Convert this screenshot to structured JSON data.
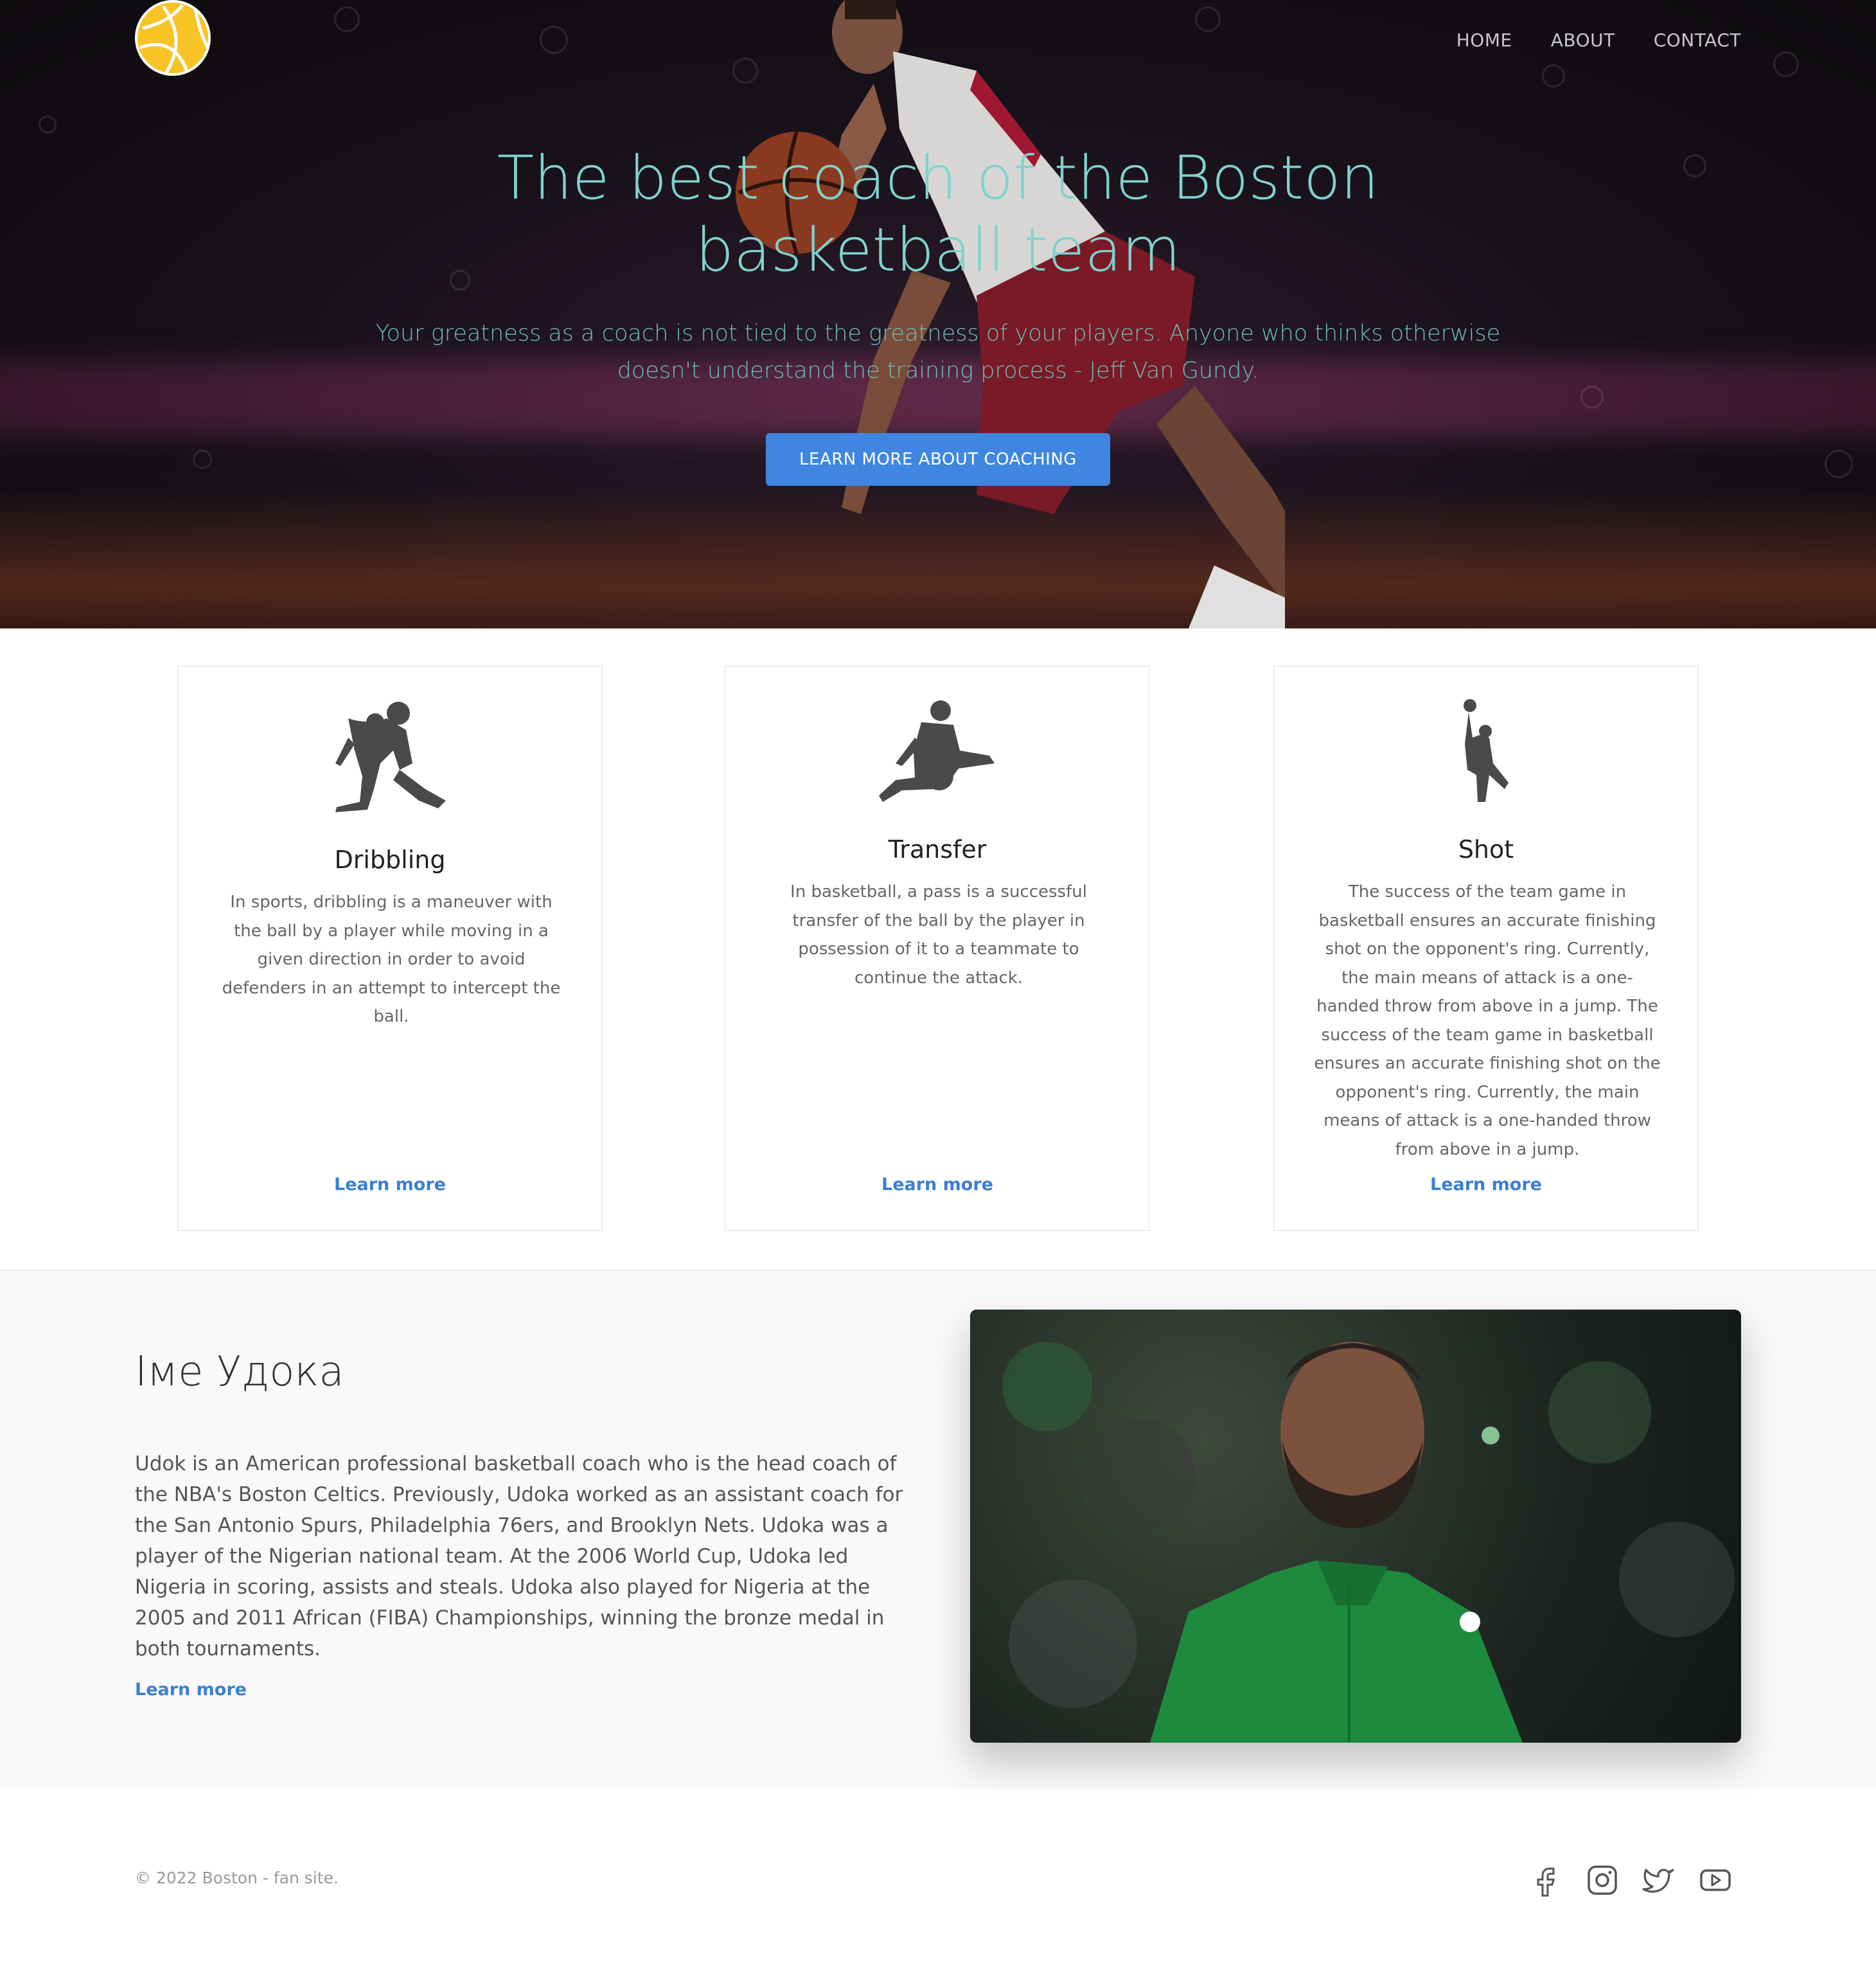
{
  "nav": {
    "items": [
      "HOME",
      "ABOUT",
      "CONTACT"
    ]
  },
  "hero": {
    "title": "The best coach of the Boston basketball team",
    "subtitle": "Your greatness as a coach is not tied to the greatness of your players. Anyone who thinks otherwise doesn't understand the training process - Jeff Van Gundy.",
    "button": "LEARN MORE ABOUT COACHING"
  },
  "features": [
    {
      "icon": "dribbling-player-icon",
      "title": "Dribbling",
      "text": "In sports, dribbling is a maneuver with the ball by a player while moving in a given direction in order to avoid defenders in an attempt to intercept the ball.",
      "link": "Learn more"
    },
    {
      "icon": "passing-player-icon",
      "title": "Transfer",
      "text": "In basketball, a pass is a successful transfer of the ball by the player in possession of it to a teammate to continue the attack.",
      "link": "Learn more"
    },
    {
      "icon": "shooting-player-icon",
      "title": "Shot",
      "text": "The success of the team game in basketball ensures an accurate finishing shot on the opponent's ring. Currently, the main means of attack is a one-handed throw from above in a jump. The success of the team game in basketball ensures an accurate finishing shot on the opponent's ring. Currently, the main means of attack is a one-handed throw from above in a jump.",
      "link": "Learn more"
    }
  ],
  "about": {
    "title": "Іме Удока",
    "text": "Udok is an American professional basketball coach who is the head coach of the NBA's Boston Celtics. Previously, Udoka worked as an assistant coach for the San Antonio Spurs, Philadelphia 76ers, and Brooklyn Nets. Udoka was a player of the Nigerian national team. At the 2006 World Cup, Udoka led Nigeria in scoring, assists and steals. Udoka also played for Nigeria at the 2005 and 2011 African (FIBA) Championships, winning the bronze medal in both tournaments.",
    "link": "Learn more"
  },
  "footer": {
    "copyright": "© 2022 Boston - fan site.",
    "social": [
      "facebook-icon",
      "instagram-icon",
      "twitter-icon",
      "youtube-icon"
    ]
  },
  "colors": {
    "accent": "#3f86e0",
    "link": "#3b7fd4",
    "hero_text": "#7ed3cf",
    "logo": "#f7c325"
  }
}
